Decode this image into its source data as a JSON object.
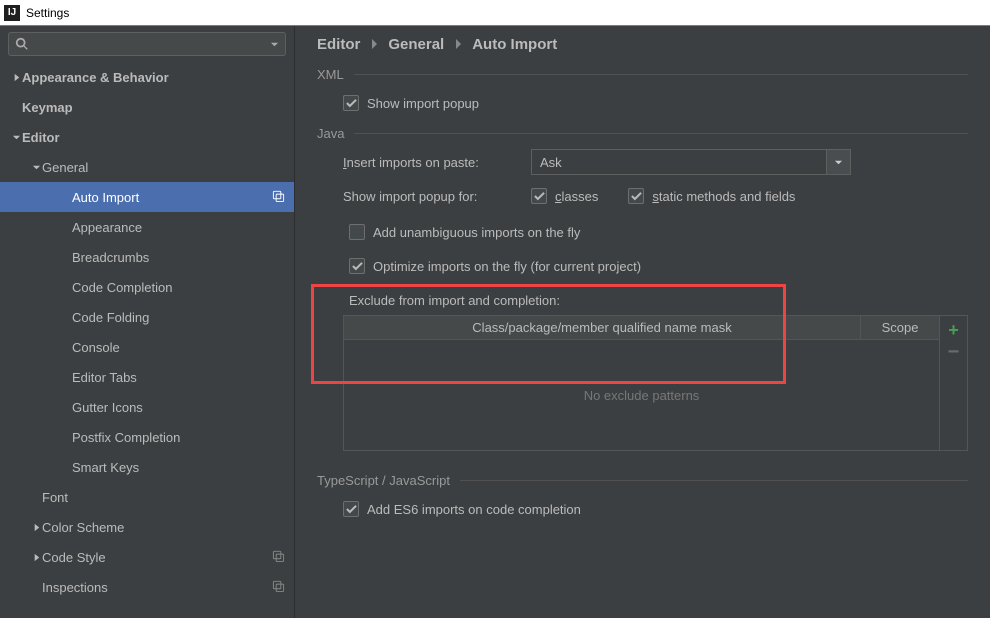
{
  "window": {
    "title": "Settings"
  },
  "sidebar": {
    "search_placeholder": "",
    "items": [
      {
        "label": "Appearance & Behavior",
        "depth": 0,
        "arrow": "right",
        "bold": true
      },
      {
        "label": "Keymap",
        "depth": 0,
        "arrow": "",
        "bold": true
      },
      {
        "label": "Editor",
        "depth": 0,
        "arrow": "down",
        "bold": true
      },
      {
        "label": "General",
        "depth": 1,
        "arrow": "down"
      },
      {
        "label": "Auto Import",
        "depth": 2,
        "selected": true,
        "badge": true
      },
      {
        "label": "Appearance",
        "depth": 2
      },
      {
        "label": "Breadcrumbs",
        "depth": 2
      },
      {
        "label": "Code Completion",
        "depth": 2
      },
      {
        "label": "Code Folding",
        "depth": 2
      },
      {
        "label": "Console",
        "depth": 2
      },
      {
        "label": "Editor Tabs",
        "depth": 2
      },
      {
        "label": "Gutter Icons",
        "depth": 2
      },
      {
        "label": "Postfix Completion",
        "depth": 2
      },
      {
        "label": "Smart Keys",
        "depth": 2
      },
      {
        "label": "Font",
        "depth": 1
      },
      {
        "label": "Color Scheme",
        "depth": 1,
        "arrow": "right"
      },
      {
        "label": "Code Style",
        "depth": 1,
        "arrow": "right",
        "badge": true
      },
      {
        "label": "Inspections",
        "depth": 1,
        "badge": true
      }
    ]
  },
  "breadcrumb": {
    "a": "Editor",
    "b": "General",
    "c": "Auto Import"
  },
  "xml": {
    "heading": "XML",
    "show_import_popup": {
      "label": "Show import popup",
      "checked": true
    }
  },
  "java": {
    "heading": "Java",
    "insert_label": "Insert imports on paste:",
    "insert_value": "Ask",
    "show_popup_for": "Show import popup for:",
    "classes": {
      "label": "classes",
      "checked": true
    },
    "static": {
      "label": "static methods and fields",
      "checked": true
    },
    "unambiguous": {
      "label": "Add unambiguous imports on the fly",
      "checked": false
    },
    "optimize": {
      "label": "Optimize imports on the fly (for current project)",
      "checked": true
    },
    "exclude_label": "Exclude from import and completion:",
    "col1": "Class/package/member qualified name mask",
    "col2": "Scope",
    "empty": "No exclude patterns"
  },
  "ts": {
    "heading": "TypeScript / JavaScript",
    "es6": {
      "label": "Add ES6 imports on code completion",
      "checked": true
    }
  }
}
